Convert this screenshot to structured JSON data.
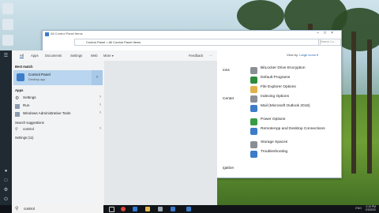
{
  "control_panel": {
    "window_title": "All Control Panel Items",
    "address_path": "Control Panel  >  All Control Panel Items",
    "search_placeholder": "Search Co...",
    "view_by_label": "View by:",
    "view_by_value": "Large icons ▾",
    "partial_left_items": [
      "ions",
      "Center",
      "",
      "",
      "",
      "",
      "igation"
    ],
    "items": [
      {
        "label": "BitLocker Drive Encryption",
        "color": "#8a8f96"
      },
      {
        "label": "Default Programs",
        "color": "#2e8b3d"
      },
      {
        "label": "File Explorer Options",
        "color": "#e0b34a"
      },
      {
        "label": "Indexing Options",
        "color": "#8a8f96"
      },
      {
        "label": "Mail (Microsoft Outlook 2016)",
        "color": "#3d7cc9"
      },
      {
        "label": "Power Options",
        "color": "#3a9b45"
      },
      {
        "label": "RemoteApp and Desktop Connections",
        "color": "#3d7cc9"
      },
      {
        "label": "Storage Spaces",
        "color": "#8a8f96"
      },
      {
        "label": "Troubleshooting",
        "color": "#3d7cc9"
      }
    ]
  },
  "start_menu": {
    "tabs": [
      "All",
      "Apps",
      "Documents",
      "Settings",
      "Web",
      "More ▾"
    ],
    "feedback": "Feedback",
    "more_dots": "···",
    "best_match_heading": "Best match",
    "best_match": {
      "name": "Control Panel",
      "sub": "Desktop app"
    },
    "apps_heading": "Apps",
    "apps": [
      "Settings",
      "Run",
      "Windows Administrative Tools"
    ],
    "search_suggestions_heading": "Search suggestions",
    "suggestion": "control",
    "settings_heading": "Settings (11)"
  },
  "taskbar": {
    "search_text": "control",
    "time": "2:10 PM",
    "date": "2/3/2020",
    "lang": "ENG"
  }
}
